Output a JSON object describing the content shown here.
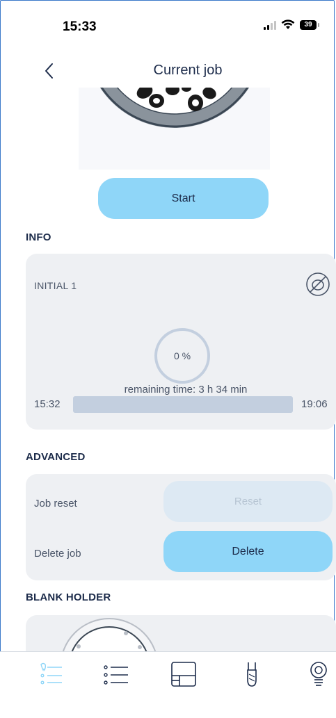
{
  "status_bar": {
    "time": "15:33",
    "battery": "39"
  },
  "header": {
    "title": "Current job"
  },
  "actions": {
    "start_label": "Start"
  },
  "info": {
    "section_title": "INFO",
    "job_name": "INITIAL 1",
    "progress_label": "0 %",
    "progress_fraction": 0,
    "remaining_time": "remaining time: 3 h 34 min",
    "start_time": "15:32",
    "end_time": "19:06"
  },
  "advanced": {
    "section_title": "ADVANCED",
    "job_reset_label": "Job reset",
    "reset_button": "Reset",
    "delete_job_label": "Delete job",
    "delete_button": "Delete"
  },
  "blank_holder": {
    "section_title": "BLANK HOLDER"
  },
  "colors": {
    "accent": "#8fd6f8",
    "text": "#1c2b4a",
    "card": "#eef0f3",
    "track": "#c3cfdf"
  },
  "tab_bar": {
    "tabs": [
      {
        "icon": "current-job-icon",
        "active": true
      },
      {
        "icon": "list-icon",
        "active": false
      },
      {
        "icon": "layout-icon",
        "active": false
      },
      {
        "icon": "tool-icon",
        "active": false
      },
      {
        "icon": "lightbulb-icon",
        "active": false
      }
    ]
  }
}
